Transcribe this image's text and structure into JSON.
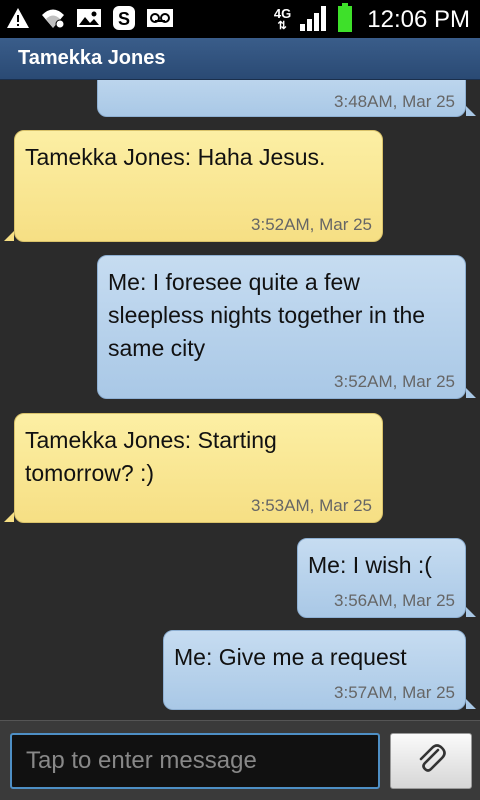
{
  "status_bar": {
    "time": "12:06 PM",
    "network": "4G",
    "icons": [
      "warning-icon",
      "wifi-icon",
      "image-icon",
      "skype-icon",
      "voicemail-icon",
      "signal-icon",
      "battery-icon"
    ]
  },
  "header": {
    "title": "Tamekka Jones"
  },
  "conversation": {
    "messages": [
      {
        "direction": "outgoing",
        "text": "",
        "timestamp": "3:48AM, Mar 25"
      },
      {
        "direction": "incoming",
        "text": "Tamekka Jones: Haha Jesus.",
        "timestamp": "3:52AM, Mar 25"
      },
      {
        "direction": "outgoing",
        "text": "Me: I foresee quite a few sleepless nights together in the same city",
        "timestamp": "3:52AM, Mar 25"
      },
      {
        "direction": "incoming",
        "text": "Tamekka Jones: Starting tomorrow?  :)",
        "timestamp": "3:53AM, Mar 25"
      },
      {
        "direction": "outgoing",
        "text": "Me: I wish :(",
        "timestamp": "3:56AM, Mar 25"
      },
      {
        "direction": "outgoing",
        "text": "Me: Give me a request",
        "timestamp": "3:57AM, Mar 25"
      }
    ]
  },
  "composer": {
    "placeholder": "Tap to enter message",
    "value": "",
    "attach_icon": "paperclip-icon"
  },
  "colors": {
    "incoming_bubble": "#f6df84",
    "outgoing_bubble": "#a9c8e6",
    "title_bar": "#2f5079",
    "background": "#2b2b2b",
    "input_border": "#4e8fc5"
  }
}
